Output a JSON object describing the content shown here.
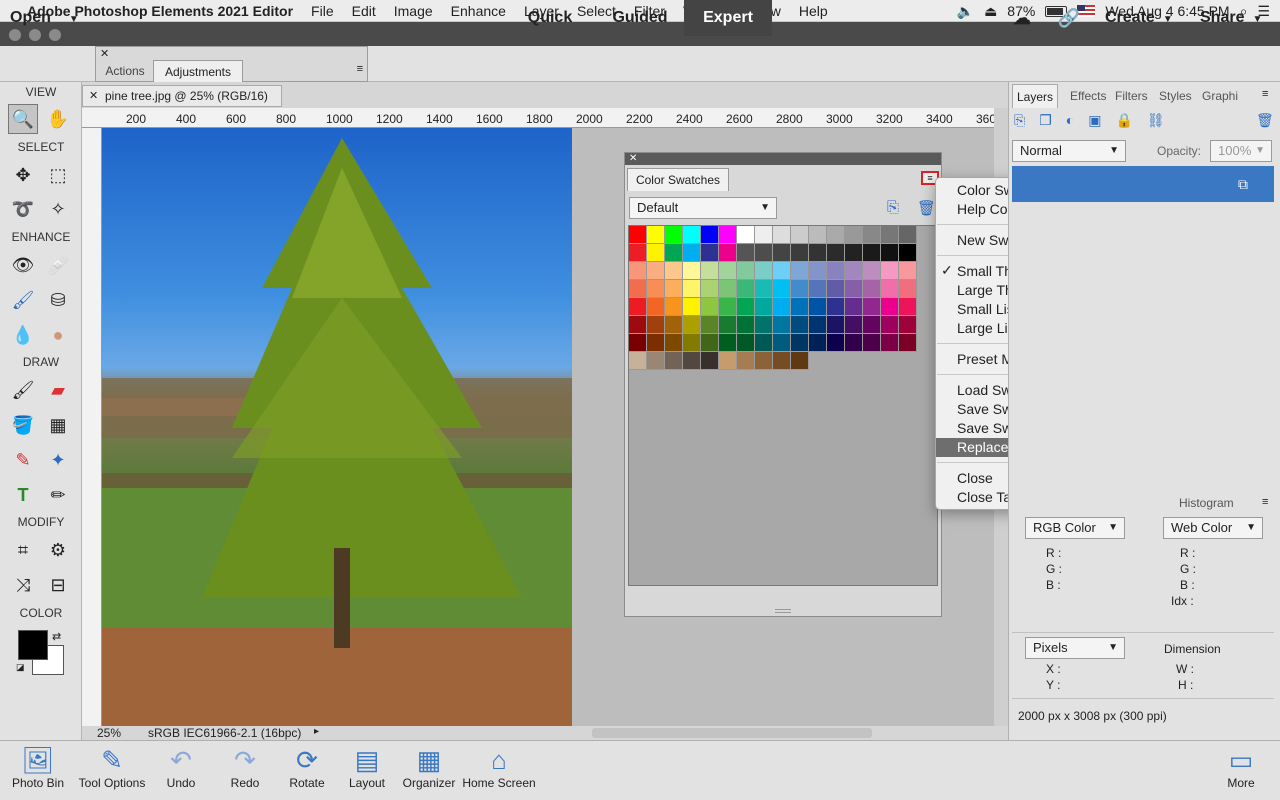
{
  "menubar": {
    "app_name": "Adobe Photoshop Elements 2021 Editor",
    "items": [
      "File",
      "Edit",
      "Image",
      "Enhance",
      "Layer",
      "Select",
      "Filter",
      "View",
      "Window",
      "Help"
    ],
    "battery": "87%",
    "datetime": "Wed Aug 4  6:45 PM"
  },
  "topbar": {
    "open_label": "Open",
    "modes": [
      "Quick",
      "Guided",
      "Expert"
    ],
    "active_mode": "Expert",
    "create_label": "Create",
    "share_label": "Share"
  },
  "floatpanel": {
    "tabs": [
      "Actions",
      "Adjustments"
    ],
    "active_tab": "Adjustments"
  },
  "document": {
    "tab_title": "pine tree.jpg @ 25% (RGB/16)",
    "zoom": "25%",
    "profile": "sRGB IEC61966-2.1 (16bpc)"
  },
  "ruler": {
    "labels": [
      "200",
      "400",
      "600",
      "800",
      "1000",
      "1200",
      "1400",
      "1600",
      "1800",
      "2000",
      "2200",
      "2400",
      "2600",
      "2800",
      "3000",
      "3200",
      "3400",
      "360"
    ]
  },
  "toolbox": {
    "sections": {
      "view": "VIEW",
      "select": "SELECT",
      "enhance": "ENHANCE",
      "draw": "DRAW",
      "modify": "MODIFY",
      "color": "COLOR"
    }
  },
  "swatches": {
    "title": "Color Swatches",
    "preset": "Default",
    "rows": [
      [
        "#ff0000",
        "#ffff00",
        "#00ff00",
        "#00ffff",
        "#0000ff",
        "#ff00ff",
        "#ffffff",
        "#eeeeee",
        "#dddddd",
        "#cccccc",
        "#bbbbbb",
        "#aaaaaa",
        "#999999",
        "#888888",
        "#777777",
        "#666666"
      ],
      [
        "#ee1c24",
        "#fff200",
        "#00a651",
        "#00aeef",
        "#2e3192",
        "#ec008c",
        "#555555",
        "#4d4d4d",
        "#444444",
        "#3c3c3c",
        "#333333",
        "#2b2b2b",
        "#222222",
        "#1a1a1a",
        "#111111",
        "#000000"
      ],
      [
        "#f7977a",
        "#f9ad81",
        "#fdc68a",
        "#fff79a",
        "#c4df9b",
        "#a3d39c",
        "#82ca9d",
        "#7bcdc8",
        "#6ecff6",
        "#7ea7d8",
        "#8493ca",
        "#8882be",
        "#a187be",
        "#bc8dbf",
        "#f49ac2",
        "#f6989d"
      ],
      [
        "#f26c4f",
        "#f68e55",
        "#fbaf5c",
        "#fff467",
        "#acd372",
        "#7cc576",
        "#3bb878",
        "#1abbb4",
        "#00bff3",
        "#438ccb",
        "#5574b9",
        "#605ca8",
        "#855fa8",
        "#a763a8",
        "#f06ea9",
        "#f26d7d"
      ],
      [
        "#ed1c24",
        "#f26522",
        "#f7941d",
        "#fff200",
        "#8dc73f",
        "#39b54a",
        "#00a651",
        "#00a99d",
        "#00aeef",
        "#0072bc",
        "#0054a6",
        "#2e3192",
        "#662d91",
        "#92278f",
        "#ec008c",
        "#ed145b"
      ],
      [
        "#9e0b0f",
        "#a0410d",
        "#a36209",
        "#aba000",
        "#598527",
        "#197b30",
        "#007236",
        "#00746b",
        "#0076a3",
        "#004b80",
        "#003471",
        "#1b1464",
        "#440e62",
        "#630460",
        "#9e005d",
        "#9e0039"
      ],
      [
        "#790000",
        "#7b2e00",
        "#7d4900",
        "#827b00",
        "#406618",
        "#005e20",
        "#005826",
        "#005952",
        "#005b7f",
        "#003663",
        "#002157",
        "#0d004c",
        "#32004b",
        "#4b0049",
        "#7b0046",
        "#7a0026"
      ],
      [
        "#c7b299",
        "#998675",
        "#736357",
        "#534741",
        "#37302d",
        "#c69c6d",
        "#a67c52",
        "#8c6239",
        "#754c24",
        "#603913"
      ]
    ]
  },
  "context_menu": {
    "items": [
      {
        "label": "Color Swatches Help"
      },
      {
        "label": "Help Contents"
      },
      {
        "label": "New Swatch..."
      },
      {
        "label": "Small Thumbnail",
        "checked": true
      },
      {
        "label": "Large Thumbnail"
      },
      {
        "label": "Small List"
      },
      {
        "label": "Large List"
      },
      {
        "label": "Preset Manager..."
      },
      {
        "label": "Load Swatches..."
      },
      {
        "label": "Save Swatches..."
      },
      {
        "label": "Save Swatches for Exchange..."
      },
      {
        "label": "Replace Swatches...",
        "highlighted": true
      },
      {
        "label": "Close"
      },
      {
        "label": "Close Tab Group"
      }
    ],
    "check_mark": "✓"
  },
  "right_panel": {
    "tabs": [
      "Layers",
      "Effects",
      "Filters",
      "Styles",
      "Graphi"
    ],
    "active_tab": "Layers",
    "blend_mode": "Normal",
    "opacity_label": "Opacity:",
    "opacity_value": "100%",
    "histogram_tab": "Histogram",
    "color_mode_left": "RGB Color",
    "color_mode_right": "Web Color",
    "left_labels": [
      "R :",
      "G :",
      "B :"
    ],
    "right_labels": [
      "R :",
      "G :",
      "B :",
      "Idx :"
    ],
    "unit": "Pixels",
    "dimension_label": "Dimension",
    "xy_labels": [
      "X :",
      "Y :"
    ],
    "wh_labels": [
      "W :",
      "H :"
    ],
    "image_info": "2000 px x 3008 px (300 ppi)"
  },
  "bottombar": {
    "items": [
      "Photo Bin",
      "Tool Options",
      "Undo",
      "Redo",
      "Rotate",
      "Layout",
      "Organizer",
      "Home Screen"
    ],
    "more": "More"
  }
}
